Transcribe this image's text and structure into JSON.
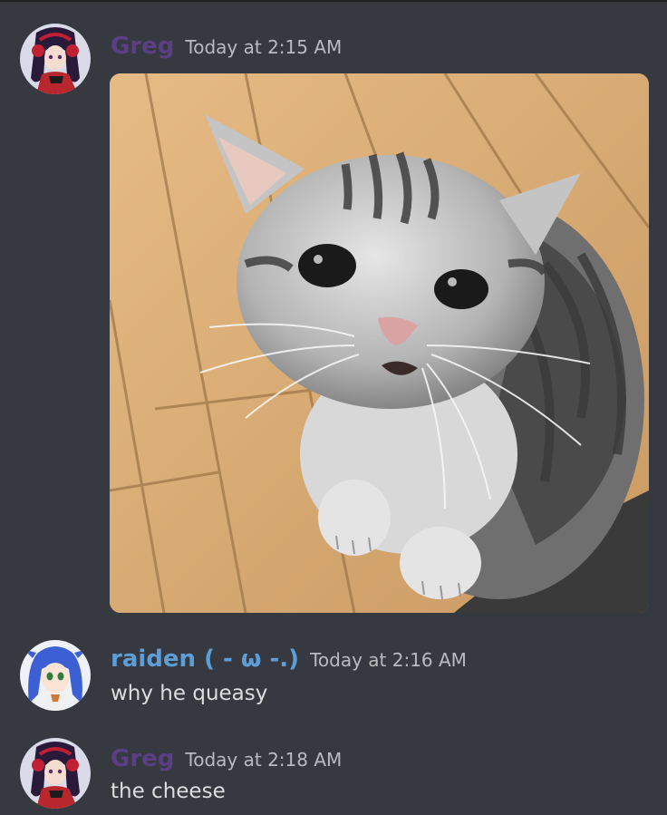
{
  "messages": [
    {
      "author": "Greg",
      "timestamp": "Today at 2:15 AM",
      "attachment": "cat-photo"
    },
    {
      "author": "raiden ( - ω -.)",
      "timestamp": "Today at 2:16 AM",
      "text": "why he queasy"
    },
    {
      "author": "Greg",
      "timestamp": "Today at 2:18 AM",
      "text": "the cheese"
    }
  ],
  "colors": {
    "background": "#36393f",
    "greg_name": "#5b3f86",
    "raiden_name": "#5d9ed8",
    "timestamp": "#b9bbbe",
    "text": "#dcddde"
  }
}
